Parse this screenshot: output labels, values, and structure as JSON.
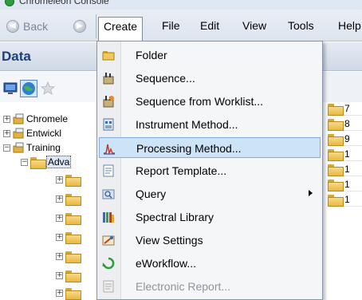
{
  "window": {
    "title": "Chromeleon Console"
  },
  "nav": {
    "back_label": "Back"
  },
  "menubar": {
    "items": [
      {
        "label": "Create"
      },
      {
        "label": "File"
      },
      {
        "label": "Edit"
      },
      {
        "label": "View"
      },
      {
        "label": "Tools"
      },
      {
        "label": "Help"
      }
    ]
  },
  "panel": {
    "title": "Data"
  },
  "tree": {
    "items": [
      {
        "label": "Chromele"
      },
      {
        "label": "Entwickl"
      },
      {
        "label": "Training"
      },
      {
        "label": "Adva"
      }
    ]
  },
  "right_list": {
    "items": [
      {
        "label": "7"
      },
      {
        "label": "8"
      },
      {
        "label": "9"
      },
      {
        "label": "1"
      },
      {
        "label": "1"
      },
      {
        "label": "1"
      },
      {
        "label": "1"
      }
    ]
  },
  "create_menu": {
    "items": [
      {
        "label": "Folder",
        "icon": "folder-icon"
      },
      {
        "label": "Sequence...",
        "icon": "sequence-icon"
      },
      {
        "label": "Sequence from Worklist...",
        "icon": "sequence-worklist-icon"
      },
      {
        "label": "Instrument Method...",
        "icon": "instrument-method-icon"
      },
      {
        "label": "Processing Method...",
        "icon": "processing-method-icon",
        "highlighted": true
      },
      {
        "label": "Report Template...",
        "icon": "report-template-icon"
      },
      {
        "label": "Query",
        "icon": "query-icon",
        "submenu": true
      },
      {
        "label": "Spectral Library",
        "icon": "spectral-library-icon"
      },
      {
        "label": "View Settings",
        "icon": "view-settings-icon"
      },
      {
        "label": "eWorkflow...",
        "icon": "eworkflow-icon"
      },
      {
        "label": "Electronic Report...",
        "icon": "electronic-report-icon",
        "disabled": true
      }
    ]
  },
  "colors": {
    "menu_highlight": "#cde3f7",
    "menu_highlight_border": "#84acd6",
    "panel_title": "#1f3f7a",
    "folder": "#e9b940"
  }
}
